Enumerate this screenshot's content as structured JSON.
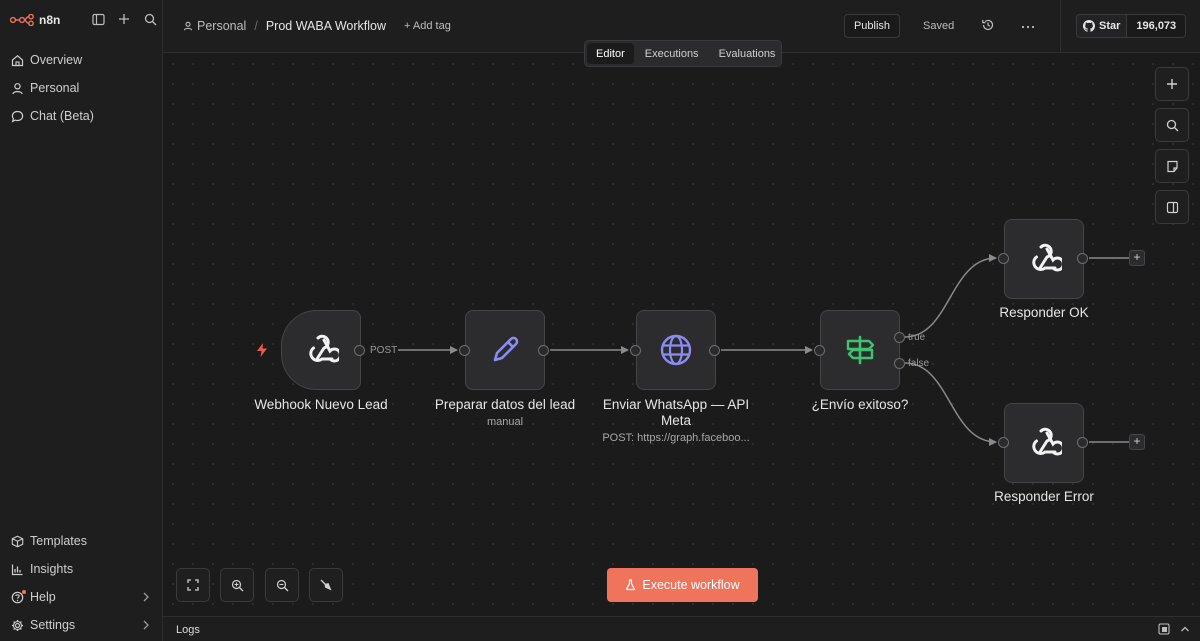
{
  "app": {
    "name": "n8n",
    "brand_color": "#f0735c"
  },
  "sidebar": {
    "top_items": [
      {
        "label": "Overview",
        "icon": "home-icon"
      },
      {
        "label": "Personal",
        "icon": "user-icon"
      },
      {
        "label": "Chat (Beta)",
        "icon": "chat-icon"
      }
    ],
    "bottom_items": [
      {
        "label": "Templates",
        "icon": "box-icon"
      },
      {
        "label": "Insights",
        "icon": "chart-icon"
      },
      {
        "label": "Help",
        "icon": "help-icon"
      },
      {
        "label": "Settings",
        "icon": "gear-icon"
      }
    ]
  },
  "header": {
    "owner": "Personal",
    "workflow_title": "Prod WABA Workflow",
    "add_tag": "+ Add tag",
    "publish": "Publish",
    "status": "Saved",
    "github_star": "Star",
    "github_count": "196,073"
  },
  "tabs": [
    "Editor",
    "Executions",
    "Evaluations"
  ],
  "active_tab": "Editor",
  "nodes": {
    "webhook": {
      "label": "Webhook Nuevo Lead",
      "icon": "webhook-icon"
    },
    "prepare": {
      "label": "Preparar datos del lead",
      "sub": "manual",
      "icon": "pencil-icon"
    },
    "whatsapp": {
      "label": "Enviar WhatsApp — API Meta",
      "sub": "POST: https://graph.faceboo...",
      "icon": "globe-icon"
    },
    "ifnode": {
      "label": "¿Envío exitoso?",
      "icon": "signpost-icon"
    },
    "ok": {
      "label": "Responder OK",
      "icon": "webhook-icon"
    },
    "error": {
      "label": "Responder Error",
      "icon": "webhook-icon"
    }
  },
  "edge_labels": {
    "post": "POST",
    "true": "true",
    "false": "false"
  },
  "execute_button": "Execute workflow",
  "logs_label": "Logs"
}
